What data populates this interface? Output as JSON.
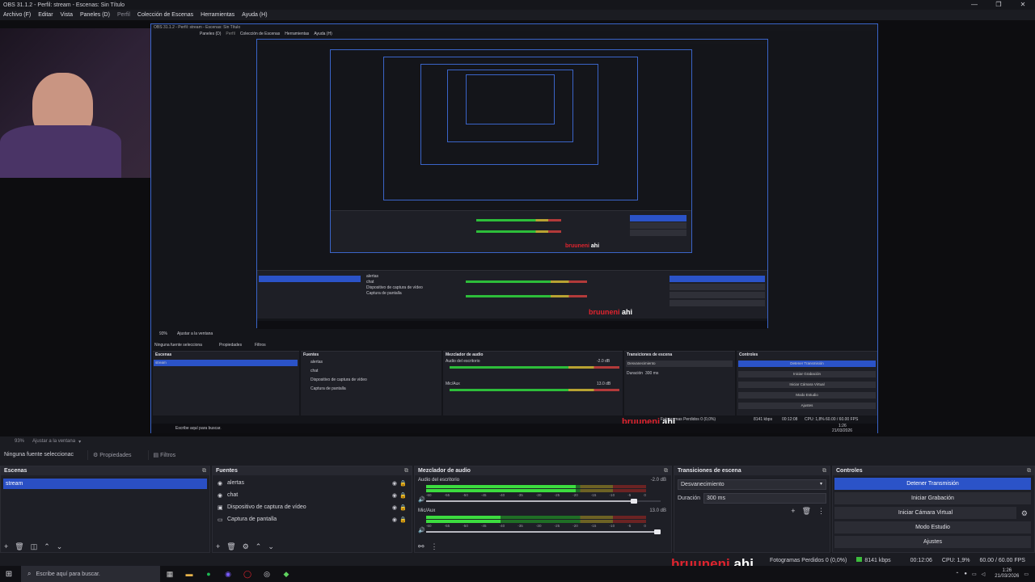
{
  "window": {
    "title": "OBS 31.1.2 - Perfil: stream - Escenas: Sin Título",
    "controls": [
      "—",
      "❐",
      "✕"
    ]
  },
  "menu": [
    "Archivo (F)",
    "Editar",
    "Vista",
    "Paneles (D)",
    "Perfil",
    "Colección de Escenas",
    "Herramientas",
    "Ayuda (H)"
  ],
  "nested_preview": {
    "title": "OBS 31.1.2 - Perfil: stream - Escenas: Sin Título",
    "menu": [
      "Paneles (D)",
      "Perfil",
      "Colección de Escenas",
      "Herramientas",
      "Ayuda (H)"
    ],
    "scale": "93%",
    "fit": "Ajustar a la ventana",
    "props_text": "Ninguna fuente selecciona",
    "props_btn": "Propiedades",
    "filters_btn": "Filtros",
    "docks": {
      "scenes": "Escenas",
      "sources": "Fuentes",
      "mixer": "Mezclador de audio",
      "transitions": "Transiciones de escena",
      "controls": "Controles"
    },
    "scene_item": "stream",
    "sources": [
      "alertas",
      "chat",
      "Dispositivo de captura de vídeo",
      "Captura de pantalla"
    ],
    "mixer": {
      "ch1": "Audio del escritorio",
      "ch1_db": "-2.0 dB",
      "ch2": "Mic/Aux",
      "ch2_db": "13.0 dB"
    },
    "transition": "Desvanecimiento",
    "duration_label": "Duración",
    "duration_value": "300 ms",
    "controls": [
      "Detener Transmisión",
      "Iniciar Grabación",
      "Iniciar Cámara Virtual",
      "Modo Estudio",
      "Ajustes"
    ],
    "status": "Fotogramas Perdidos 0 (0,0%)",
    "kbps": "8141 kbps",
    "time": "00:12:08",
    "cpu": "CPU: 1,8%",
    "fps": "60.00 / 60.00 FPS",
    "search": "Escribe aquí para buscar.",
    "clock": "1:26",
    "date": "21/03/2026"
  },
  "brand": {
    "red": "bruuneni",
    "white": "ahi"
  },
  "scalebar": {
    "scale": "93%",
    "fit": "Ajustar a la ventana"
  },
  "properties_bar": {
    "text": "Ninguna fuente seleccionac",
    "properties": "Propiedades",
    "filters": "Filtros"
  },
  "scenes": {
    "title": "Escenas",
    "items": [
      "stream"
    ]
  },
  "sources": {
    "title": "Fuentes",
    "items": [
      {
        "label": "alertas",
        "icon": "alert-icon"
      },
      {
        "label": "chat",
        "icon": "browser-icon"
      },
      {
        "label": "Dispositivo de captura de vídeo",
        "icon": "camera-icon"
      },
      {
        "label": "Captura de pantalla",
        "icon": "monitor-icon"
      }
    ]
  },
  "mixer": {
    "title": "Mezclador de audio",
    "scale": [
      "-60",
      "-55",
      "-50",
      "-45",
      "-40",
      "-35",
      "-30",
      "-25",
      "-20",
      "-15",
      "-10",
      "-5",
      "0"
    ],
    "channels": [
      {
        "name": "Audio del escritorio",
        "db": "-2.0 dB",
        "level": 0.68,
        "volume": 0.9
      },
      {
        "name": "Mic/Aux",
        "db": "13.0 dB",
        "level": 0.34,
        "volume": 1.0
      }
    ]
  },
  "transitions": {
    "title": "Transiciones de escena",
    "selected": "Desvanecimiento",
    "duration_label": "Duración",
    "duration_value": "300 ms"
  },
  "controls": {
    "title": "Controles",
    "buttons": [
      "Detener Transmisión",
      "Iniciar Grabación",
      "Iniciar Cámara Virtual",
      "Modo Estudio",
      "Ajustes"
    ]
  },
  "status": {
    "dropped": "Fotogramas Perdidos 0 (0,0%)",
    "kbps": "8141 kbps",
    "time": "00:12:06",
    "cpu": "CPU: 1,9%",
    "fps": "60.00 / 60.00 FPS"
  },
  "taskbar": {
    "search": "Escribe aquí para buscar.",
    "time": "1:26",
    "date": "21/03/2026"
  },
  "colors": {
    "accent": "#2b53c8",
    "meter_green": "#3cdc3f",
    "brand_red": "#e0242e"
  }
}
